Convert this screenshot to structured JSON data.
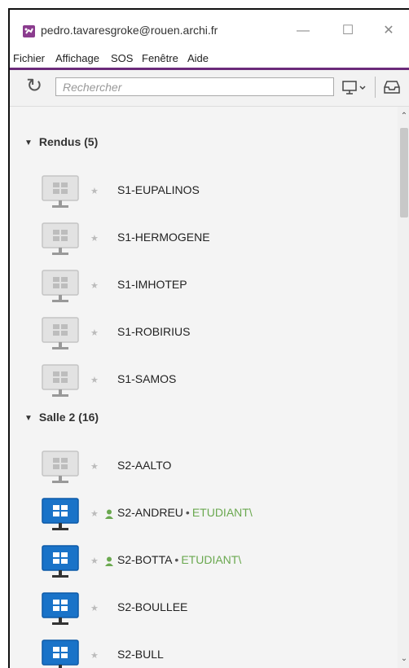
{
  "window": {
    "title": "pedro.tavaresgroke@rouen.archi.fr"
  },
  "menu": [
    "Fichier",
    "Affichage",
    "SOS",
    "Fenêtre",
    "Aide"
  ],
  "toolbar": {
    "search_placeholder": "Rechercher"
  },
  "groups": [
    {
      "label": "Rendus (5)",
      "machines": [
        {
          "name": "S1-EUPALINOS",
          "online": false
        },
        {
          "name": "S1-HERMOGENE",
          "online": false
        },
        {
          "name": "S1-IMHOTEP",
          "online": false
        },
        {
          "name": "S1-ROBIRIUS",
          "online": false
        },
        {
          "name": "S1-SAMOS",
          "online": false
        }
      ]
    },
    {
      "label": "Salle 2 (16)",
      "machines": [
        {
          "name": "S2-AALTO",
          "online": false
        },
        {
          "name": "S2-ANDREU",
          "online": true,
          "session": "ETUDIANT\\"
        },
        {
          "name": "S2-BOTTA",
          "online": true,
          "session": "ETUDIANT\\"
        },
        {
          "name": "S2-BOULLEE",
          "online": true
        },
        {
          "name": "S2-BULL",
          "online": true
        }
      ]
    }
  ],
  "colors": {
    "accent": "#6b2a7a",
    "online": "#1a73c8",
    "session": "#6aa84f"
  }
}
